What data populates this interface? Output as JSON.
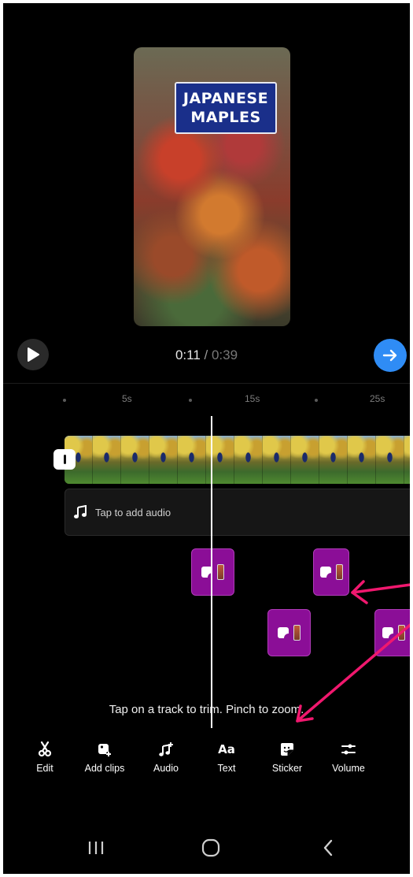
{
  "preview": {
    "sign_line1": "JAPANESE",
    "sign_line2": "MAPLES"
  },
  "playback": {
    "current_time": "0:11",
    "separator": " / ",
    "total_time": "0:39",
    "play_icon": "play-icon",
    "next_icon": "arrow-right-icon",
    "accent_color": "#2f8cf5"
  },
  "ruler": {
    "labels": [
      "5s",
      "15s",
      "25s"
    ]
  },
  "tracks": {
    "audio_label": "Tap to add audio",
    "sticker_color": "#8b0e97"
  },
  "hint_text": "Tap on a track to trim. Pinch to zoom.",
  "toolbar": {
    "items": [
      {
        "label": "Edit",
        "icon": "scissors-icon"
      },
      {
        "label": "Add clips",
        "icon": "add-clip-icon"
      },
      {
        "label": "Audio",
        "icon": "music-add-icon"
      },
      {
        "label": "Text",
        "icon": "text-icon"
      },
      {
        "label": "Sticker",
        "icon": "sticker-icon"
      },
      {
        "label": "Volume",
        "icon": "sliders-icon"
      }
    ]
  },
  "annotation_color": "#f0186e"
}
